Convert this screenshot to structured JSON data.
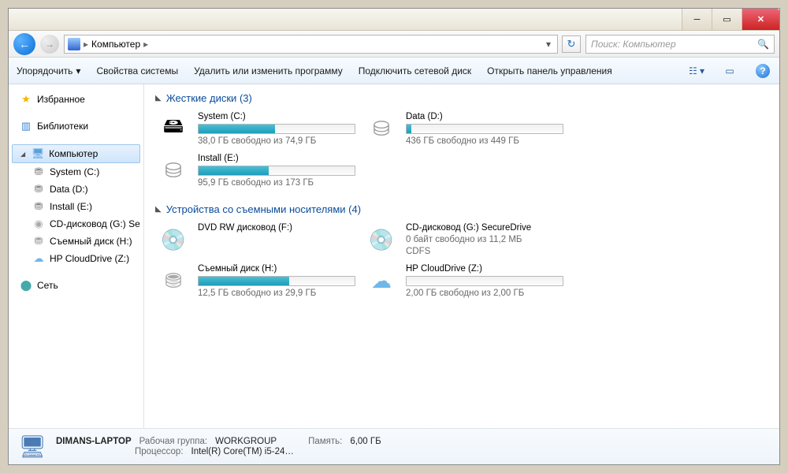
{
  "window": {
    "title": ""
  },
  "nav": {
    "breadcrumb": "Компьютер",
    "breadcrumb_sep": "▸",
    "search_placeholder": "Поиск: Компьютер"
  },
  "toolbar": {
    "organize": "Упорядочить",
    "properties": "Свойства системы",
    "uninstall": "Удалить или изменить программу",
    "map_drive": "Подключить сетевой диск",
    "control_panel": "Открыть панель управления"
  },
  "sidebar": {
    "favorites": "Избранное",
    "libraries": "Библиотеки",
    "computer": "Компьютер",
    "drives": [
      {
        "label": "System (C:)"
      },
      {
        "label": "Data (D:)"
      },
      {
        "label": "Install (E:)"
      },
      {
        "label": "CD-дисковод (G:) Se"
      },
      {
        "label": "Съемный диск (H:)"
      },
      {
        "label": "HP CloudDrive (Z:)"
      }
    ],
    "network": "Сеть"
  },
  "sections": {
    "hdd": {
      "title": "Жесткие диски",
      "count": "(3)"
    },
    "removable": {
      "title": "Устройства со съемными носителями",
      "count": "(4)"
    }
  },
  "drives_hdd": [
    {
      "name": "System (C:)",
      "sub": "38,0 ГБ свободно из 74,9 ГБ",
      "fill": 49,
      "icon": "hdd-win"
    },
    {
      "name": "Data (D:)",
      "sub": "436 ГБ свободно из 449 ГБ",
      "fill": 3,
      "icon": "hdd"
    },
    {
      "name": "Install (E:)",
      "sub": "95,9 ГБ свободно из 173 ГБ",
      "fill": 45,
      "icon": "hdd"
    }
  ],
  "drives_removable": [
    {
      "name": "DVD RW дисковод (F:)",
      "sub": "",
      "fill": null,
      "icon": "dvd"
    },
    {
      "name": "CD-дисковод (G:) SecureDrive",
      "sub": "0 байт свободно из 11,2 МБ",
      "sub2": "CDFS",
      "fill": null,
      "icon": "cd"
    },
    {
      "name": "Съемный диск (H:)",
      "sub": "12,5 ГБ свободно из 29,9 ГБ",
      "fill": 58,
      "icon": "usb"
    },
    {
      "name": "HP CloudDrive (Z:)",
      "sub": "2,00 ГБ свободно из 2,00 ГБ",
      "fill": 0,
      "icon": "cloud"
    }
  ],
  "status": {
    "name": "DIMANS-LAPTOP",
    "workgroup_label": "Рабочая группа:",
    "workgroup": "WORKGROUP",
    "memory_label": "Память:",
    "memory": "6,00 ГБ",
    "cpu_label": "Процессор:",
    "cpu": "Intel(R) Core(TM) i5-24…"
  }
}
